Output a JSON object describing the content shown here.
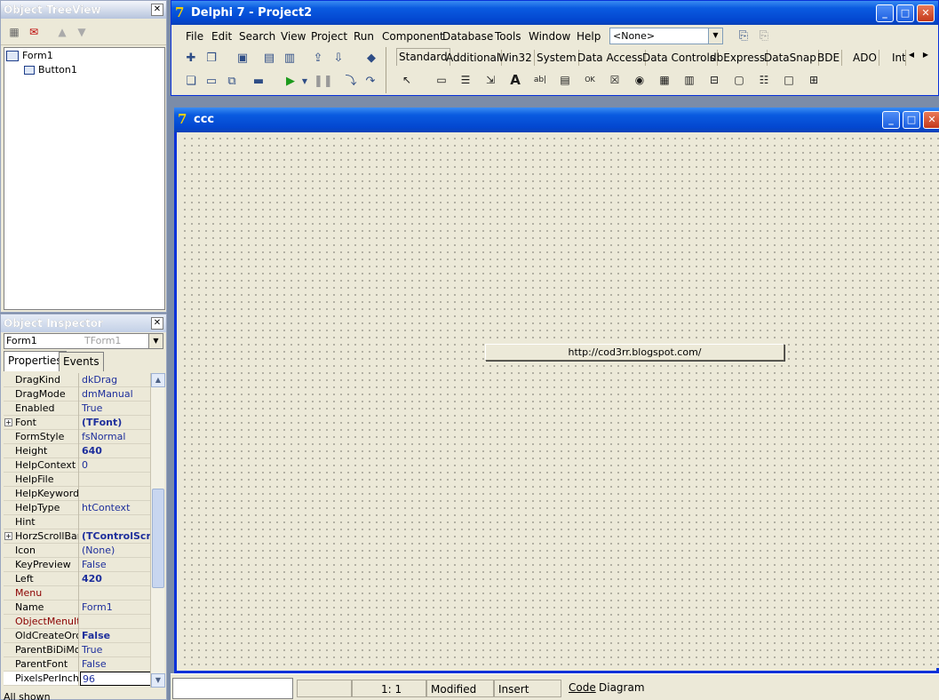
{
  "treeview": {
    "title": "Object TreeView",
    "close_glyph": "✕",
    "items": [
      {
        "label": "Form1"
      },
      {
        "label": "Button1"
      }
    ]
  },
  "inspector": {
    "title": "Object Inspector",
    "close_glyph": "✕",
    "selected_object": "Form1",
    "selected_class": "TForm1",
    "tabs": [
      "Properties",
      "Events"
    ],
    "status": "All shown",
    "properties": [
      {
        "name": "DragKind",
        "value": "dkDrag"
      },
      {
        "name": "DragMode",
        "value": "dmManual"
      },
      {
        "name": "Enabled",
        "value": "True"
      },
      {
        "name": "Font",
        "value": "(TFont)",
        "bold": true,
        "expandable": true
      },
      {
        "name": "FormStyle",
        "value": "fsNormal"
      },
      {
        "name": "Height",
        "value": "640",
        "bold": true
      },
      {
        "name": "HelpContext",
        "value": "0"
      },
      {
        "name": "HelpFile",
        "value": ""
      },
      {
        "name": "HelpKeyword",
        "value": ""
      },
      {
        "name": "HelpType",
        "value": "htContext"
      },
      {
        "name": "Hint",
        "value": ""
      },
      {
        "name": "HorzScrollBar",
        "value": "(TControlScrollBar)",
        "bold": true,
        "expandable": true
      },
      {
        "name": "Icon",
        "value": "(None)"
      },
      {
        "name": "KeyPreview",
        "value": "False"
      },
      {
        "name": "Left",
        "value": "420",
        "bold": true
      },
      {
        "name": "Menu",
        "value": "",
        "red": true
      },
      {
        "name": "Name",
        "value": "Form1"
      },
      {
        "name": "ObjectMenuItem",
        "value": "",
        "red": true
      },
      {
        "name": "OldCreateOrder",
        "value": "False",
        "bold": true
      },
      {
        "name": "ParentBiDiMode",
        "value": "True"
      },
      {
        "name": "ParentFont",
        "value": "False"
      },
      {
        "name": "PixelsPerInch",
        "value": "96",
        "selected": true
      }
    ]
  },
  "main": {
    "title": "Delphi 7 - Project2",
    "logo_glyph": "7",
    "menu": [
      "File",
      "Edit",
      "Search",
      "View",
      "Project",
      "Run",
      "Component",
      "Database",
      "Tools",
      "Window",
      "Help"
    ],
    "combo_value": "<None>",
    "palette_tabs": [
      "Standard",
      "Additional",
      "Win32",
      "System",
      "Data Access",
      "Data Controls",
      "dbExpress",
      "DataSnap",
      "BDE",
      "ADO",
      "InterBase"
    ],
    "active_palette_tab": "Standard"
  },
  "form": {
    "caption": "ccc",
    "logo_glyph": "7",
    "button_caption": "http://cod3rr.blogspot.com/"
  },
  "statusbar": {
    "position": "1:   1",
    "modified": "Modified",
    "mode": "Insert",
    "tabs": [
      "Code",
      "Diagram"
    ]
  },
  "colors": {
    "xp_title_blue": "#0347d0",
    "window_face": "#ece9d8",
    "property_value": "#1e2f9c",
    "property_name_red": "#8b0000"
  }
}
